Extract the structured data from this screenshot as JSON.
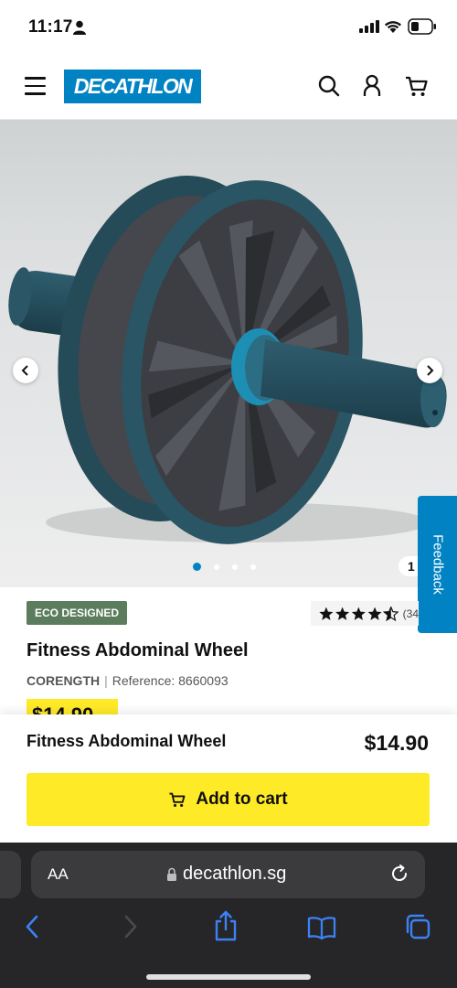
{
  "status_bar": {
    "time": "11:17"
  },
  "header": {
    "logo": "DECATHLON",
    "icons": [
      "menu-icon",
      "search-icon",
      "account-icon",
      "cart-icon"
    ]
  },
  "gallery": {
    "counter": "1",
    "dots": 4,
    "active_dot": 1
  },
  "feedback": {
    "label": "Feedback"
  },
  "product": {
    "badge": "ECO DESIGNED",
    "rating": 4.5,
    "rating_count": "(34",
    "title": "Fitness Abdominal Wheel",
    "brand": "CORENGTH",
    "separator": "|",
    "reference": "Reference: 8660093",
    "price_peek": "$14.90"
  },
  "sticky_bar": {
    "name": "Fitness Abdominal Wheel",
    "price": "$14.90",
    "add_to_cart": "Add to cart"
  },
  "browser": {
    "aa_label": "AA",
    "url": "decathlon.sg"
  },
  "colors": {
    "brand": "#0082c3",
    "cta": "#ffea28",
    "eco": "#5b7d5e"
  }
}
